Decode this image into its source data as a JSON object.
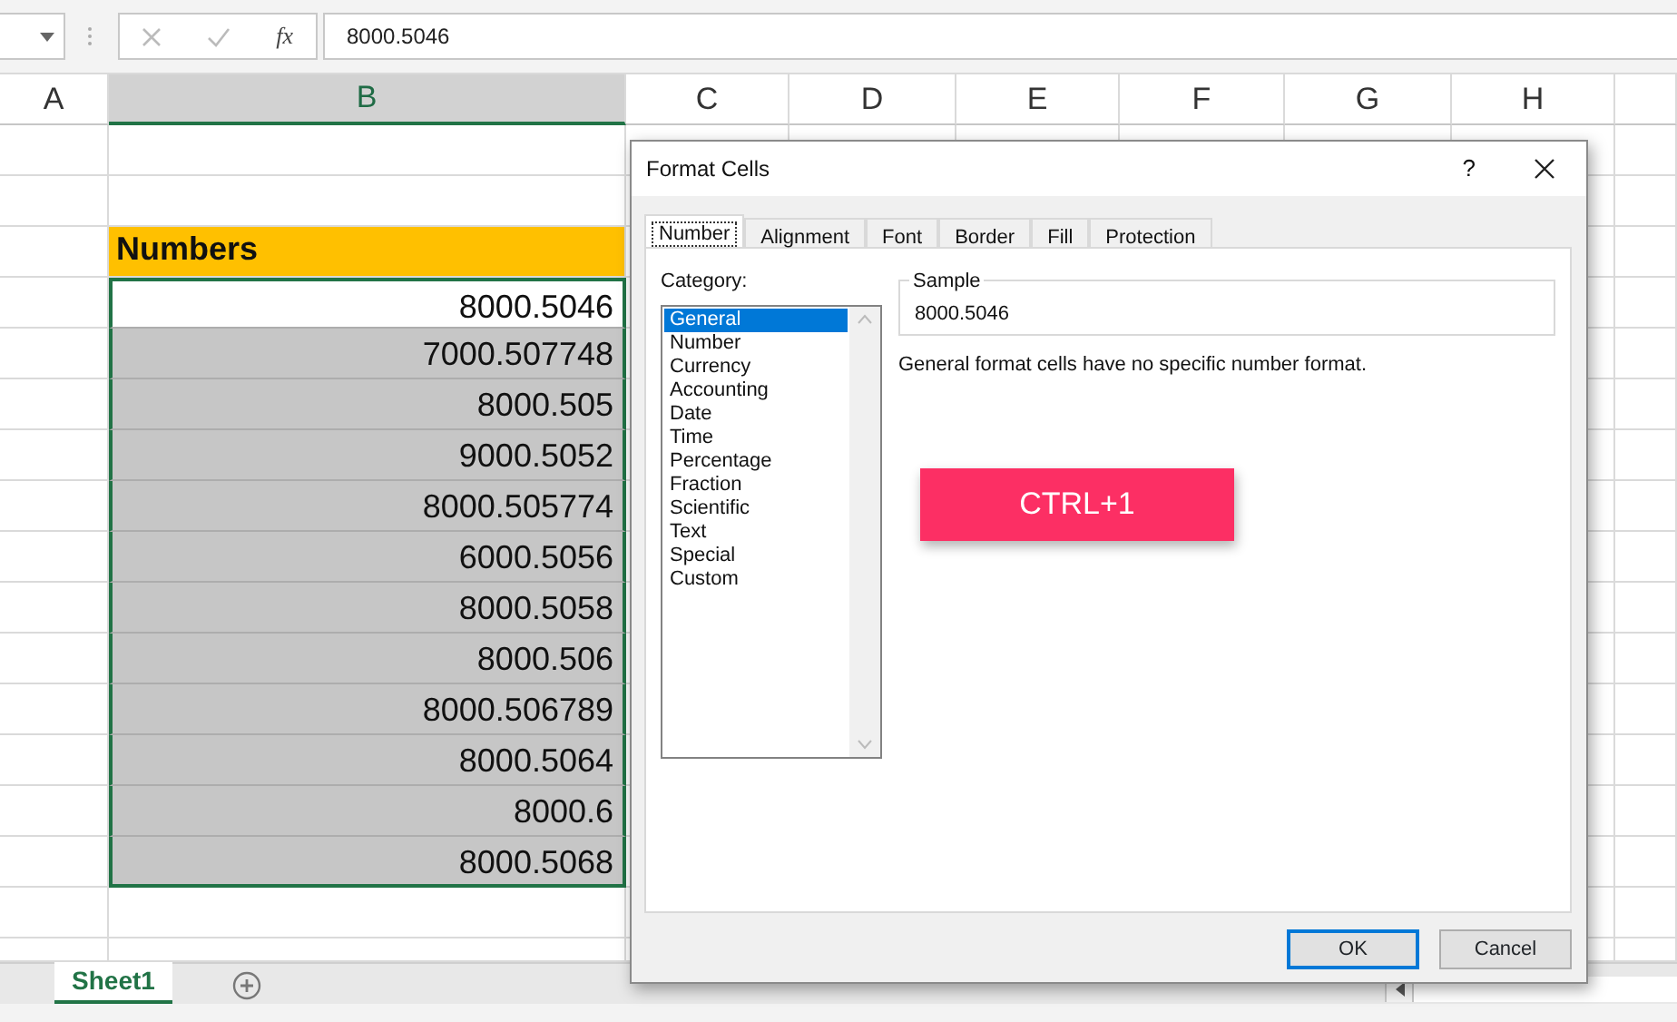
{
  "formula_bar": {
    "function_symbol": "fx",
    "value": "8000.5046"
  },
  "columns": [
    {
      "label": "A",
      "selected": false
    },
    {
      "label": "B",
      "selected": true
    },
    {
      "label": "C",
      "selected": false
    },
    {
      "label": "D",
      "selected": false
    },
    {
      "label": "E",
      "selected": false
    },
    {
      "label": "F",
      "selected": false
    },
    {
      "label": "G",
      "selected": false
    },
    {
      "label": "H",
      "selected": false
    }
  ],
  "header_cell": "Numbers",
  "cells": [
    {
      "value": "8000.5046",
      "active": true
    },
    {
      "value": "7000.507748",
      "active": false
    },
    {
      "value": "8000.505",
      "active": false
    },
    {
      "value": "9000.5052",
      "active": false
    },
    {
      "value": "8000.505774",
      "active": false
    },
    {
      "value": "6000.5056",
      "active": false
    },
    {
      "value": "8000.5058",
      "active": false
    },
    {
      "value": "8000.506",
      "active": false
    },
    {
      "value": "8000.506789",
      "active": false
    },
    {
      "value": "8000.5064",
      "active": false
    },
    {
      "value": "8000.6",
      "active": false
    },
    {
      "value": "8000.5068",
      "active": false
    }
  ],
  "sheet_tabs": [
    {
      "label": "Sheet1",
      "selected": true
    }
  ],
  "dialog": {
    "title": "Format Cells",
    "help": "?",
    "tabs": [
      {
        "label": "Number",
        "selected": true
      },
      {
        "label": "Alignment",
        "selected": false
      },
      {
        "label": "Font",
        "selected": false
      },
      {
        "label": "Border",
        "selected": false
      },
      {
        "label": "Fill",
        "selected": false
      },
      {
        "label": "Protection",
        "selected": false
      }
    ],
    "category_label": "Category:",
    "categories": [
      {
        "label": "General",
        "selected": true
      },
      {
        "label": "Number",
        "selected": false
      },
      {
        "label": "Currency",
        "selected": false
      },
      {
        "label": "Accounting",
        "selected": false
      },
      {
        "label": "Date",
        "selected": false
      },
      {
        "label": "Time",
        "selected": false
      },
      {
        "label": "Percentage",
        "selected": false
      },
      {
        "label": "Fraction",
        "selected": false
      },
      {
        "label": "Scientific",
        "selected": false
      },
      {
        "label": "Text",
        "selected": false
      },
      {
        "label": "Special",
        "selected": false
      },
      {
        "label": "Custom",
        "selected": false
      }
    ],
    "sample_label": "Sample",
    "sample_value": "8000.5046",
    "description": "General format cells have no specific number format.",
    "buttons": [
      {
        "label": "OK",
        "default": true
      },
      {
        "label": "Cancel",
        "default": false
      }
    ]
  },
  "callout": "CTRL+1"
}
